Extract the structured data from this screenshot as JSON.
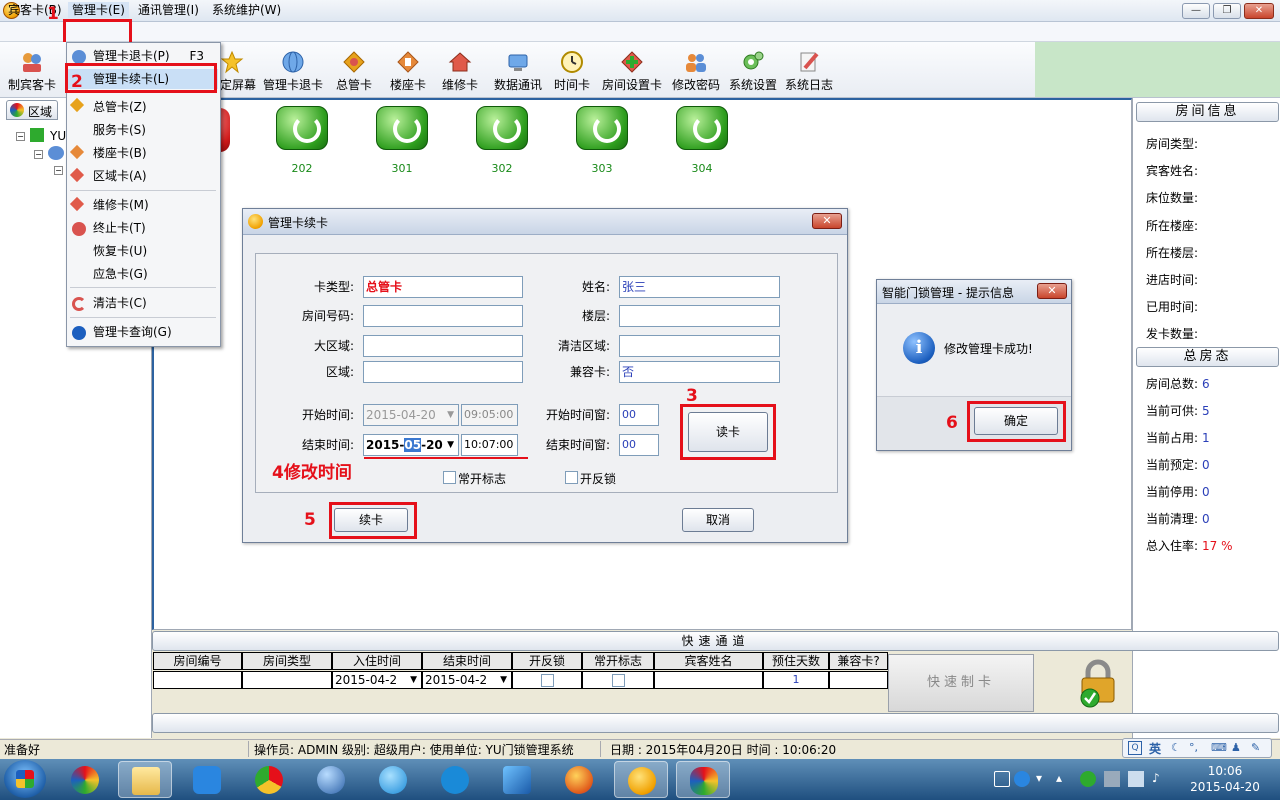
{
  "menubar": [
    "宾客卡(B)",
    "管理卡(E)",
    "通讯管理(I)",
    "系统维护(W)"
  ],
  "toolbar": [
    {
      "label": "制宾客卡"
    },
    {
      "label": "锁定屏幕"
    },
    {
      "label": "管理卡退卡"
    },
    {
      "label": "总管卡"
    },
    {
      "label": "楼座卡"
    },
    {
      "label": "维修卡"
    },
    {
      "label": "数据通讯"
    },
    {
      "label": "时间卡"
    },
    {
      "label": "房间设置卡"
    },
    {
      "label": "修改密码"
    },
    {
      "label": "系统设置"
    },
    {
      "label": "系统日志"
    }
  ],
  "left_panel": {
    "tab": "区域",
    "tree_root": "YU"
  },
  "dropdown": {
    "items": [
      {
        "label": "管理卡退卡(P)",
        "shortcut": "F3"
      },
      {
        "label": "管理卡续卡(L)",
        "shortcut": ""
      },
      {
        "label": "总管卡(Z)",
        "shortcut": ""
      },
      {
        "label": "服务卡(S)",
        "shortcut": ""
      },
      {
        "label": "楼座卡(B)",
        "shortcut": ""
      },
      {
        "label": "区域卡(A)",
        "shortcut": ""
      },
      {
        "label": "维修卡(M)",
        "shortcut": ""
      },
      {
        "label": "终止卡(T)",
        "shortcut": ""
      },
      {
        "label": "恢复卡(U)",
        "shortcut": ""
      },
      {
        "label": "应急卡(G)",
        "shortcut": ""
      },
      {
        "label": "清洁卡(C)",
        "shortcut": ""
      },
      {
        "label": "管理卡查询(G)",
        "shortcut": ""
      }
    ]
  },
  "rooms": [
    "202",
    "301",
    "302",
    "303",
    "304"
  ],
  "dialog": {
    "title": "管理卡续卡",
    "close": "✕",
    "card_type_label": "卡类型:",
    "card_type_value": "总管卡",
    "name_label": "姓名:",
    "name_value": "张三",
    "room_no_label": "房间号码:",
    "floor_label": "楼层:",
    "big_area_label": "大区域:",
    "clean_area_label": "清洁区域:",
    "area_label": "区域:",
    "compat_label": "兼容卡:",
    "compat_value": "否",
    "start_time_label": "开始时间:",
    "start_date": "2015-04-20",
    "start_time": "09:05:00",
    "end_time_label": "结束时间:",
    "end_date_pre": "2015-",
    "end_date_sel": "05",
    "end_date_post": "-20",
    "end_time": "10:07:00",
    "start_window_label": "开始时间窗:",
    "start_window": "00",
    "end_window_label": "结束时间窗:",
    "end_window": "00",
    "always_open": "常开标志",
    "anti_lock": "开反锁",
    "read_card": "读卡",
    "renew": "续卡",
    "cancel": "取消"
  },
  "message_box": {
    "title": "智能门锁管理 - 提示信息",
    "text": "修改管理卡成功!",
    "ok": "确定",
    "close": "✕"
  },
  "annotations": {
    "n1": "1",
    "n2": "2",
    "n3": "3",
    "n4": "4修改时间",
    "n5": "5",
    "n6": "6"
  },
  "room_info": {
    "header": "房间信息",
    "fields": [
      "房间类型:",
      "宾客姓名:",
      "床位数量:",
      "所在楼座:",
      "所在楼层:",
      "进店时间:",
      "已用时间:",
      "发卡数量:"
    ]
  },
  "totals": {
    "header": "总房态",
    "rows": [
      {
        "label": "房间总数:",
        "value": "6"
      },
      {
        "label": "当前可供:",
        "value": "5"
      },
      {
        "label": "当前占用:",
        "value": "1"
      },
      {
        "label": "当前预定:",
        "value": "0"
      },
      {
        "label": "当前停用:",
        "value": "0"
      },
      {
        "label": "当前清理:",
        "value": "0"
      },
      {
        "label": "总入住率:",
        "value": "17 %"
      }
    ]
  },
  "quick": {
    "title": "快速通道",
    "columns": [
      "房间编号",
      "房间类型",
      "入住时间",
      "结束时间",
      "开反锁",
      "常开标志",
      "宾客姓名",
      "预住天数",
      "兼容卡?"
    ],
    "checkin": "2015-04-2",
    "checkout": "2015-04-2",
    "days": "1",
    "button": "快速制卡"
  },
  "status": {
    "ready": "准备好",
    "operator": "操作员: ADMIN 级别: 超级用户: 使用单位: YU门锁管理系统",
    "datetime": "日期 : 2015年04月20日 时间 : 10:06:20"
  },
  "ime": {
    "lang": "英"
  },
  "clock": {
    "time": "10:06",
    "date": "2015-04-20"
  },
  "colors": {
    "accent_red": "#e5101a",
    "value_blue": "#2a3fb8",
    "room_green": "#198a19"
  }
}
